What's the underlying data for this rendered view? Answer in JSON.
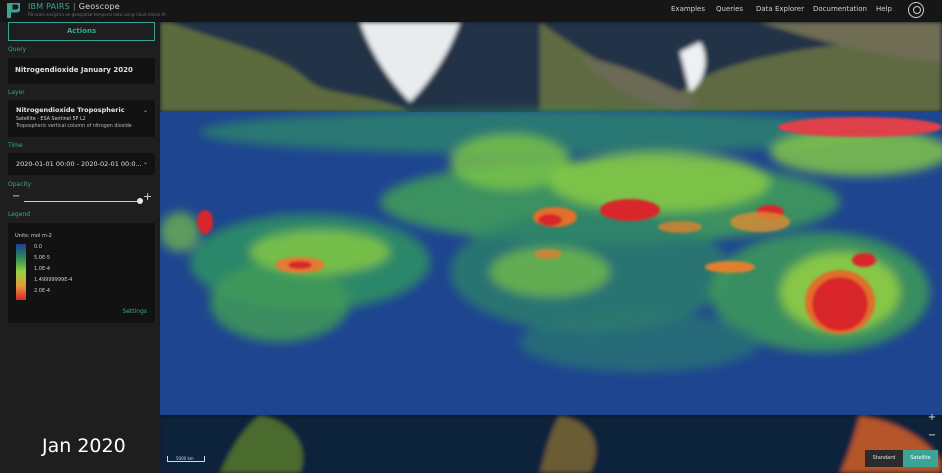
{
  "brand": {
    "name": "IBM PAIRS",
    "separator": "|",
    "app": "Geoscope",
    "tagline": "PB-scale analytics on geospatial-temporal data using cloud-native AI",
    "logo_glyph": "P",
    "accent_color": "#3aa597"
  },
  "nav": {
    "items": [
      "Examples",
      "Queries",
      "Data Explorer",
      "Documentation",
      "Help"
    ],
    "user_icon": "user-circle-icon"
  },
  "sidebar": {
    "actions_label": "Actions",
    "query": {
      "label": "Query",
      "value": "Nitrogendioxide January 2020"
    },
    "layer": {
      "label": "Layer",
      "title": "Nitrogendioxide Tropospheric",
      "subtitle": "Satellite - ESA Sentinel 5P L2",
      "description": "Tropospheric vertical column of nitrogen dioxide"
    },
    "time": {
      "label": "Time",
      "value": "2020-01-01 00:00 - 2020-02-01 00:0..."
    },
    "opacity": {
      "label": "Opacity",
      "minus": "−",
      "plus": "+",
      "value": 1.0
    },
    "legend": {
      "label": "Legend",
      "units": "Units: mol m-2",
      "entries": [
        "0.0",
        "5.0E-5",
        "1.0E-4",
        "1.49999999E-4",
        "2.0E-4"
      ],
      "colors": [
        "#1d3f91",
        "#2f8a5a",
        "#9bd33f",
        "#e39a3a",
        "#d8282b"
      ],
      "settings_label": "Settings"
    }
  },
  "map": {
    "caption": "Jan 2020",
    "scale_label": "5000 km",
    "zoom_in": "+",
    "zoom_out": "−",
    "basemap_standard": "Standard",
    "basemap_satellite": "Satellite"
  }
}
